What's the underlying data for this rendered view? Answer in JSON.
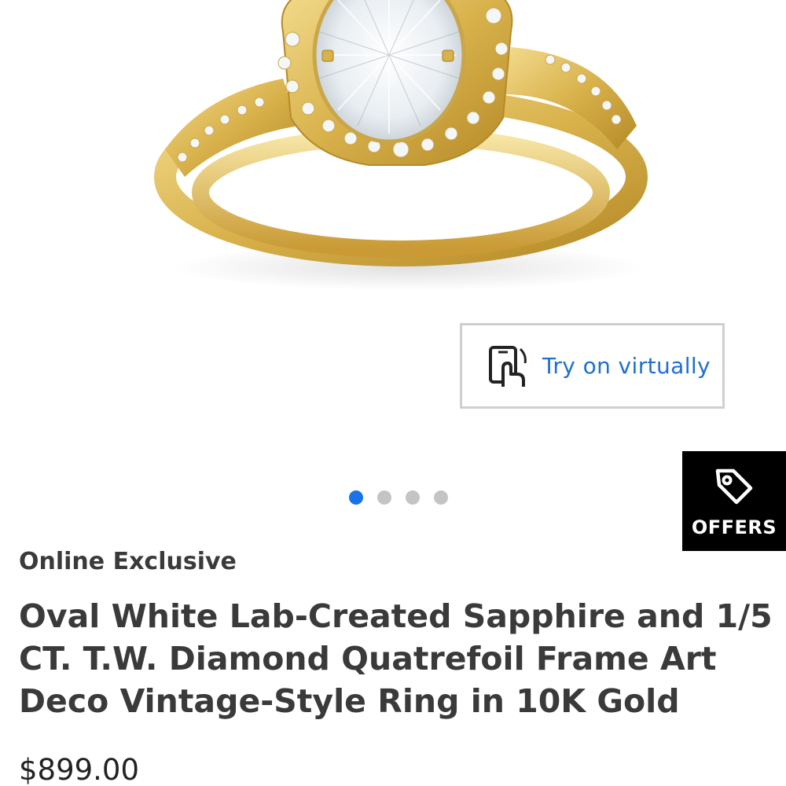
{
  "product_image": {
    "alt": "Oval White Lab-Created Sapphire ring in 10K yellow gold"
  },
  "try_on": {
    "label": "Try on virtually",
    "icon": "phone-hand-icon"
  },
  "carousel": {
    "total": 4,
    "active_index": 0
  },
  "offers": {
    "label": "OFFERS",
    "icon": "tag-icon"
  },
  "product": {
    "badge": "Online Exclusive",
    "title": "Oval White Lab-Created Sapphire and 1/5 CT. T.W. Diamond Quatrefoil Frame Art Deco Vintage-Style Ring in 10K Gold",
    "price": "$899.00"
  },
  "colors": {
    "gold": "#e4c66a",
    "link_blue": "#1f6fd1",
    "active_dot": "#1a73e8",
    "offers_bg": "#000000"
  }
}
